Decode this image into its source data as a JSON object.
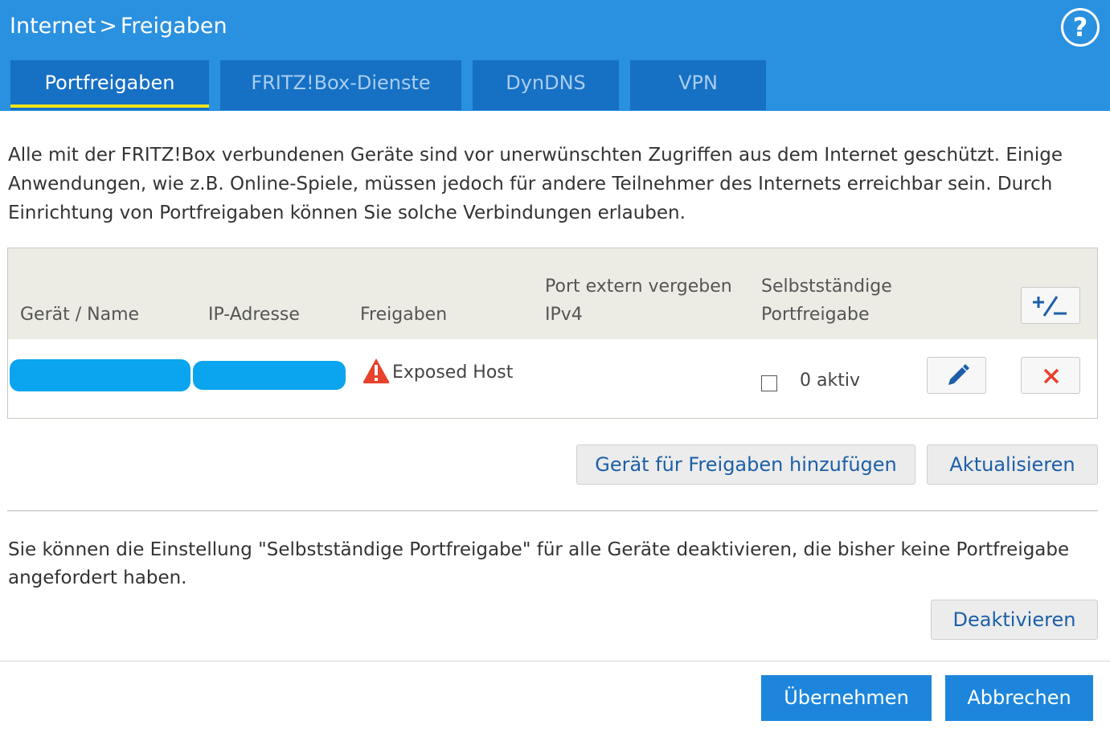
{
  "header": {
    "breadcrumb_parent": "Internet",
    "breadcrumb_separator": ">",
    "breadcrumb_current": "Freigaben",
    "help_label": "?"
  },
  "tabs": [
    {
      "label": "Portfreigaben",
      "active": true
    },
    {
      "label": "FRITZ!Box-Dienste",
      "active": false
    },
    {
      "label": "DynDNS",
      "active": false
    },
    {
      "label": "VPN",
      "active": false
    }
  ],
  "intro_text": "Alle mit der FRITZ!Box verbundenen Geräte sind vor unerwünschten Zugriffen aus dem Internet geschützt. Einige Anwendungen, wie z.B. Online-Spiele, müssen jedoch für andere Teilnehmer des Internets erreichbar sein. Durch Einrichtung von Portfreigaben können Sie solche Verbindungen erlauben.",
  "table": {
    "columns": {
      "device": "Gerät / Name",
      "ip": "IP-Adresse",
      "shares": "Freigaben",
      "port_line1": "Port extern vergeben",
      "port_line2": "IPv4",
      "auto_line1": "Selbstständige",
      "auto_line2": "Portfreigabe"
    },
    "toggle_icon": "plus-minus-icon",
    "rows": [
      {
        "device": "",
        "ip": "",
        "share_icon": "warning-icon",
        "share": "Exposed Host",
        "port": "",
        "auto_checked": false,
        "auto_status": "0 aktiv",
        "edit_icon": "pencil-icon",
        "delete_icon": "close-icon"
      }
    ]
  },
  "actions": {
    "add_device": "Gerät für Freigaben hinzufügen",
    "refresh": "Aktualisieren"
  },
  "note_text": "Sie können die Einstellung \"Selbstständige Portfreigabe\" für alle Geräte deaktivieren, die bisher keine Portfreigabe angefordert haben.",
  "deactivate_label": "Deaktivieren",
  "footer": {
    "apply_label": "Übernehmen",
    "cancel_label": "Abbrechen"
  },
  "colors": {
    "header_bg": "#2a90e0",
    "tab_bg": "#1670c4",
    "tab_active_underline": "#f2e21b",
    "link_text": "#1c5fa8",
    "primary_button": "#1d86dc",
    "delete_red": "#e8412c",
    "warning_red": "#e8412c"
  }
}
